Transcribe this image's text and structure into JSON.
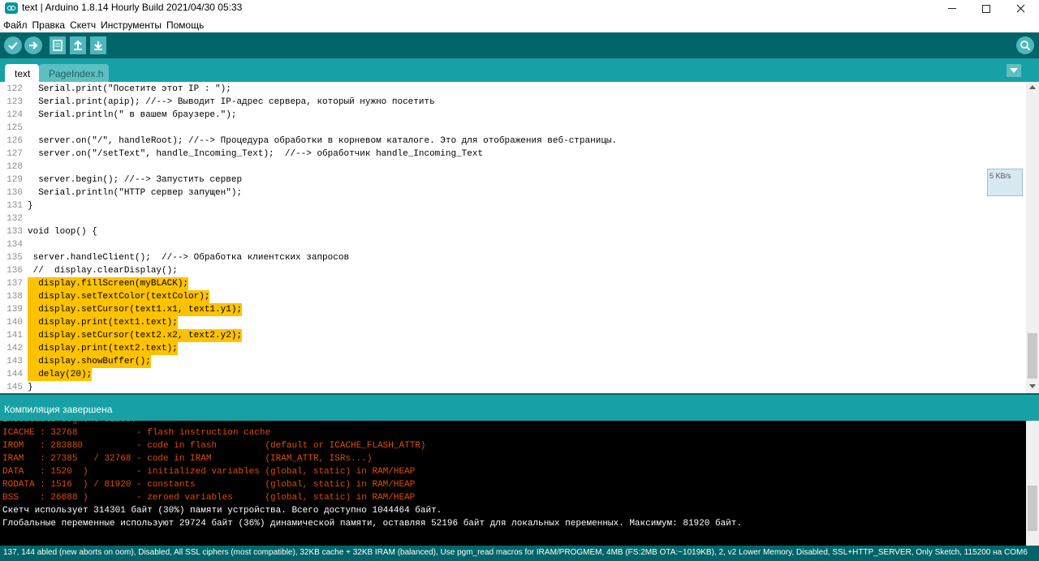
{
  "window": {
    "title": "text | Arduino 1.8.14 Hourly Build 2021/04/30 05:33",
    "minimize": "–",
    "maximize": "□",
    "close": "✕"
  },
  "menu": [
    "Файл",
    "Правка",
    "Скетч",
    "Инструменты",
    "Помощь"
  ],
  "toolbar": {
    "buttons": [
      "verify-icon",
      "upload-icon",
      "new-icon",
      "open-icon",
      "save-icon"
    ],
    "serial_monitor": "serial-monitor-icon"
  },
  "tabs": [
    "text",
    "PageIndex.h"
  ],
  "editor": {
    "lines": [
      {
        "n": "122",
        "code": "  Serial.print(\"Посетите этот IP : \");"
      },
      {
        "n": "123",
        "code": "  Serial.print(apip); //--> Выводит IP-адрес сервера, который нужно посетить"
      },
      {
        "n": "124",
        "code": "  Serial.println(\" в вашем браузере.\");"
      },
      {
        "n": "125",
        "code": ""
      },
      {
        "n": "126",
        "code": "  server.on(\"/\", handleRoot); //--> Процедура обработки в корневом каталоге. Это для отображения веб-страницы."
      },
      {
        "n": "127",
        "code": "  server.on(\"/setText\", handle_Incoming_Text);  //--> обработчик handle_Incoming_Text"
      },
      {
        "n": "128",
        "code": ""
      },
      {
        "n": "129",
        "code": "  server.begin(); //--> Запустить сервер"
      },
      {
        "n": "130",
        "code": "  Serial.println(\"HTTP сервер запущен\");"
      },
      {
        "n": "131",
        "code": "}"
      },
      {
        "n": "132",
        "code": ""
      },
      {
        "n": "133",
        "code": "void loop() {"
      },
      {
        "n": "134",
        "code": ""
      },
      {
        "n": "135",
        "code": " server.handleClient();  //--> Обработка клиентских запросов"
      },
      {
        "n": "136",
        "code": " //  display.clearDisplay();"
      },
      {
        "n": "137",
        "code": "  display.fillScreen(myBLACK);"
      },
      {
        "n": "138",
        "code": "  display.setTextColor(textColor);"
      },
      {
        "n": "139",
        "code": "  display.setCursor(text1.x1, text1.y1);"
      },
      {
        "n": "140",
        "code": "  display.print(text1.text);"
      },
      {
        "n": "141",
        "code": "  display.setCursor(text2.x2, text2.y2);"
      },
      {
        "n": "142",
        "code": "  display.print(text2.text);"
      },
      {
        "n": "143",
        "code": "  display.showBuffer();"
      },
      {
        "n": "144",
        "code": "  delay(20);"
      },
      {
        "n": "145",
        "code": "}"
      }
    ]
  },
  "speed_widget": "5 KB/s",
  "status": "Компиляция завершена",
  "console": {
    "lines": [
      {
        "text": "Executable segment sizes:",
        "color": "red"
      },
      {
        "text": "ICACHE : 32768           - flash instruction cache",
        "color": "red"
      },
      {
        "text": "IROM   : 283880          - code in flash         (default or ICACHE_FLASH_ATTR)",
        "color": "red"
      },
      {
        "text": "IRAM   : 27385   / 32768 - code in IRAM          (IRAM_ATTR, ISRs...)",
        "color": "red"
      },
      {
        "text": "DATA   : 1520  )         - initialized variables (global, static) in RAM/HEAP",
        "color": "red"
      },
      {
        "text": "RODATA : 1516  ) / 81920 - constants             (global, static) in RAM/HEAP",
        "color": "red"
      },
      {
        "text": "BSS    : 26688 )         - zeroed variables      (global, static) in RAM/HEAP",
        "color": "red"
      },
      {
        "text": "Скетч использует 314301 байт (30%) памяти устройства. Всего доступно 1044464 байт.",
        "color": "white"
      },
      {
        "text": "Глобальные переменные используют 29724 байт (36%) динамической памяти, оставляя 52196 байт для локальных переменных. Максимум: 81920 байт.",
        "color": "white"
      }
    ]
  },
  "bottom_bar": "137, 144 abled (new aborts on oom), Disabled, All SSL ciphers (most compatible), 32KB cache + 32KB IRAM (balanced), Use pgm_read macros for IRAM/PROGMEM, 4MB (FS:2MB OTA:~1019KB), 2, v2 Lower Memory, Disabled, SSL+HTTP_SERVER, Only Sketch, 115200 на COM6"
}
